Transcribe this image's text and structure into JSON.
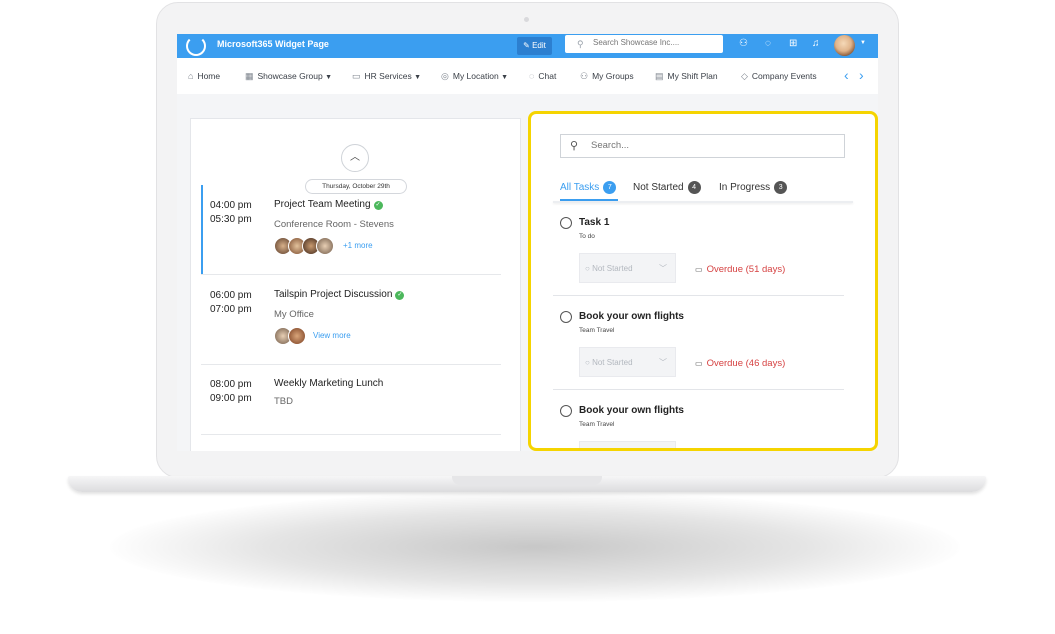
{
  "app": {
    "title": "Microsoft365 Widget Page",
    "edit_label": "Edit",
    "search_placeholder": "Search Showcase Inc...."
  },
  "topbar_icons": [
    "people-icon",
    "chat-icon",
    "apps-grid-icon",
    "bell-icon"
  ],
  "nav": [
    {
      "label": "Home",
      "icon": "home-icon"
    },
    {
      "label": "Showcase Group",
      "icon": "building-icon",
      "dropdown": "▼"
    },
    {
      "label": "HR Services",
      "icon": "folder-icon",
      "dropdown": "▼"
    },
    {
      "label": "My Location",
      "icon": "globe-icon",
      "dropdown": "▼"
    },
    {
      "label": "Chat",
      "icon": "chat-icon"
    },
    {
      "label": "My Groups",
      "icon": "groups-icon"
    },
    {
      "label": "My Shift Plan",
      "icon": "calendar-icon"
    },
    {
      "label": "Company Events",
      "icon": "tag-icon"
    }
  ],
  "calendar": {
    "date": "Thursday, October 29th",
    "events": [
      {
        "start": "04:00 pm",
        "end": "05:30 pm",
        "title": "Project Team Meeting",
        "location": "Conference Room - Stevens",
        "more": "+1 more"
      },
      {
        "start": "06:00 pm",
        "end": "07:00 pm",
        "title": "Tailspin Project Discussion",
        "location": "My Office",
        "more": "View more"
      },
      {
        "start": "08:00 pm",
        "end": "09:00 pm",
        "title": "Weekly Marketing Lunch",
        "location": "TBD"
      }
    ]
  },
  "tasks": {
    "search_placeholder": "Search...",
    "tabs": [
      {
        "label": "All Tasks",
        "count": "7"
      },
      {
        "label": "Not Started",
        "count": "4"
      },
      {
        "label": "In Progress",
        "count": "3"
      }
    ],
    "items": [
      {
        "title": "Task 1",
        "bucket": "To do",
        "status": "Not Started",
        "due": "Overdue (51 days)"
      },
      {
        "title": "Book your own flights",
        "bucket": "Team Travel",
        "status": "Not Started",
        "due": "Overdue (46 days)"
      },
      {
        "title": "Book your own flights",
        "bucket": "Team Travel"
      }
    ]
  },
  "colors": {
    "accent": "#3b9ef0",
    "overdue": "#d64242",
    "highlight": "#f5d400",
    "success": "#4cb85c"
  }
}
